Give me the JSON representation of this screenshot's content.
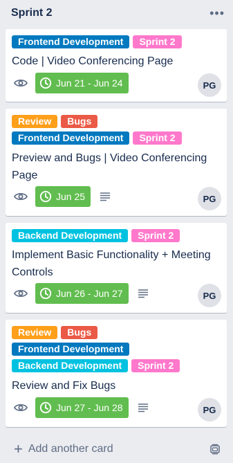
{
  "list": {
    "title": "Sprint 2",
    "menu_icon": "ellipsis-icon"
  },
  "colors": {
    "frontend": "#0079bf",
    "backend": "#00c2e0",
    "sprint": "#ff78cb",
    "review": "#ff9f1a",
    "bugs": "#eb5a46",
    "due": "#61bd4f"
  },
  "cards": [
    {
      "labels": [
        "Frontend Development",
        "Sprint 2"
      ],
      "title": "Code | Video Conferencing Page",
      "due": "Jun 21 - Jun 24",
      "member": "PG"
    },
    {
      "labels": [
        "Review",
        "Bugs",
        "Frontend Development",
        "Sprint 2"
      ],
      "title": "Preview and Bugs | Video Conferencing Page",
      "due": "Jun 25",
      "member": "PG"
    },
    {
      "labels": [
        "Backend Development",
        "Sprint 2"
      ],
      "title": "Implement Basic Functionality + Meeting Controls",
      "due": "Jun 26 - Jun 27",
      "member": "PG"
    },
    {
      "labels": [
        "Review",
        "Bugs",
        "Frontend Development",
        "Backend Development",
        "Sprint 2"
      ],
      "title": "Review and Fix Bugs",
      "due": "Jun 27 - Jun 28",
      "member": "PG"
    }
  ],
  "footer": {
    "add_card_label": "Add another card"
  }
}
